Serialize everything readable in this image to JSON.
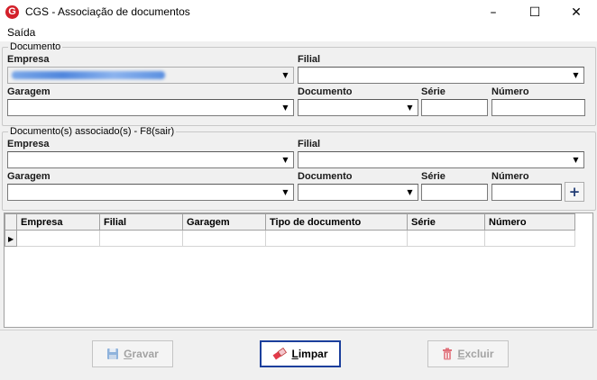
{
  "window": {
    "title": "CGS - Associação de documentos",
    "app_letter": "G",
    "minimize": "–",
    "maximize": "☐",
    "close": "✕"
  },
  "menu": {
    "items": [
      "Saída"
    ]
  },
  "documento": {
    "legend": "Documento",
    "empresa_label": "Empresa",
    "filial_label": "Filial",
    "garagem_label": "Garagem",
    "documento_label": "Documento",
    "serie_label": "Série",
    "numero_label": "Número"
  },
  "associados": {
    "legend": "Documento(s) associado(s) - F8(sair)",
    "empresa_label": "Empresa",
    "filial_label": "Filial",
    "garagem_label": "Garagem",
    "documento_label": "Documento",
    "serie_label": "Série",
    "numero_label": "Número",
    "add_label": "+"
  },
  "grid": {
    "columns": [
      "Empresa",
      "Filial",
      "Garagem",
      "Tipo de documento",
      "Série",
      "Número"
    ],
    "row_pointer": "▶"
  },
  "buttons": {
    "gravar_mn": "G",
    "gravar_rest": "ravar",
    "limpar_mn": "L",
    "limpar_rest": "impar",
    "excluir_mn": "E",
    "excluir_rest": "xcluir"
  },
  "colors": {
    "accent": "#1b3f9c",
    "app_red": "#d3202a"
  }
}
